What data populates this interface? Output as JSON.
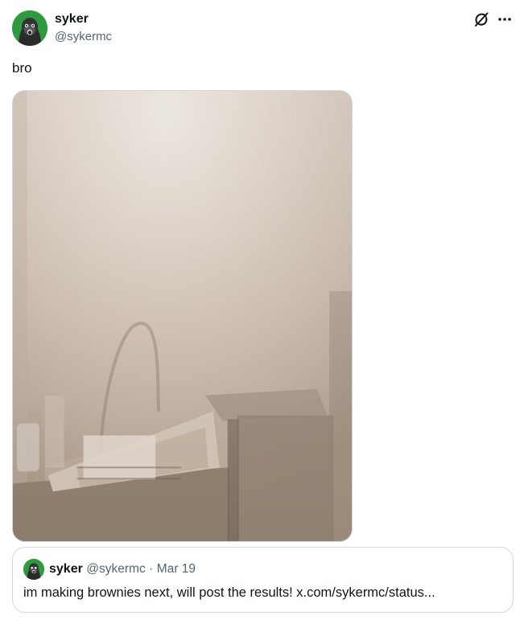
{
  "author": {
    "display_name": "syker",
    "handle": "@sykermc"
  },
  "tweet": {
    "text": "bro"
  },
  "quote": {
    "display_name": "syker",
    "handle": "@sykermc",
    "separator": "·",
    "date": "Mar 19",
    "text": "im making brownies next, will post the results! x.com/sykermc/status..."
  },
  "icons": {
    "grok": "grok-icon",
    "more": "more-options-icon"
  }
}
